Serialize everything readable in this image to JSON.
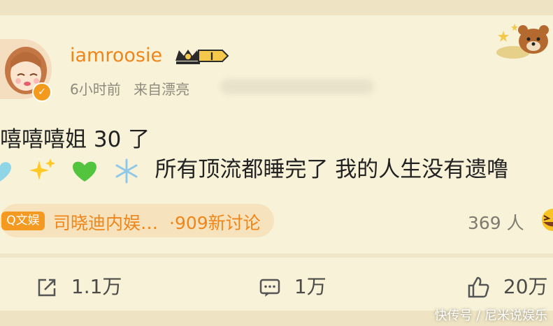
{
  "post": {
    "username": "iamroosie",
    "level_badge": "I",
    "time": "6小时前",
    "source_prefix": "来自漂亮",
    "line1": "嘻嘻嘻姐 30 了",
    "line2": "所有顶流都睡完了 我的人生没有遗噜"
  },
  "topic": {
    "tag": "Q文娱",
    "name": "司晓迪内娱…",
    "count": "·909新讨论"
  },
  "reactions": {
    "people": "369 人"
  },
  "actions": {
    "share": "1.1万",
    "comment": "1万",
    "like": "20万"
  },
  "watermark": "快传号 / 尼米说娱乐",
  "colors": {
    "accent": "#f08519",
    "background": "#f8f2d8",
    "pill_bg": "#f6e3bd",
    "tag_bg": "#f59a20"
  }
}
